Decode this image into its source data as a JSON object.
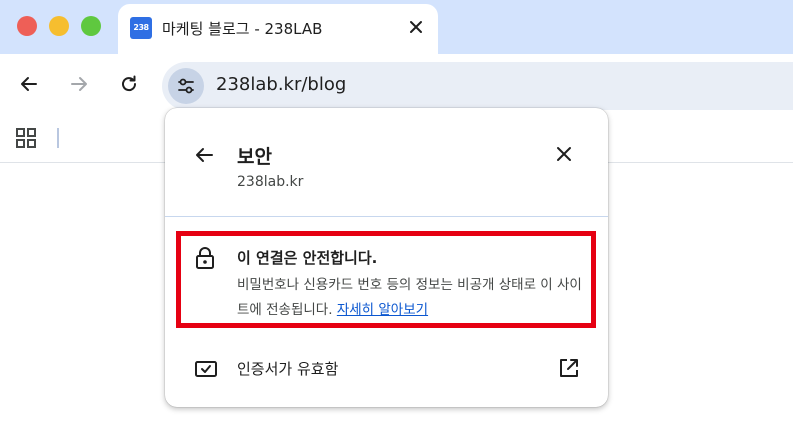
{
  "browser": {
    "tab": {
      "favicon_text": "238",
      "title": "마케팅 블로그 - 238LAB"
    },
    "address_bar": {
      "url": "238lab.kr/blog"
    }
  },
  "security_popup": {
    "title": "보안",
    "domain": "238lab.kr",
    "connection": {
      "title": "이 연결은 안전합니다.",
      "description": "비밀번호나 신용카드 번호 등의 정보는 비공개 상태로 이 사이트에 전송됩니다.",
      "learn_more": "자세히 알아보기"
    },
    "certificate": {
      "label": "인증서가 유효함"
    }
  },
  "colors": {
    "tabbar_bg": "#d3e3fd",
    "highlight_border": "#e60012",
    "link": "#0b57d0"
  },
  "icons": [
    "close-icon",
    "back-arrow-icon",
    "forward-arrow-icon",
    "reload-icon",
    "site-settings-icon",
    "apps-grid-icon",
    "lock-icon",
    "certificate-icon",
    "external-link-icon"
  ]
}
